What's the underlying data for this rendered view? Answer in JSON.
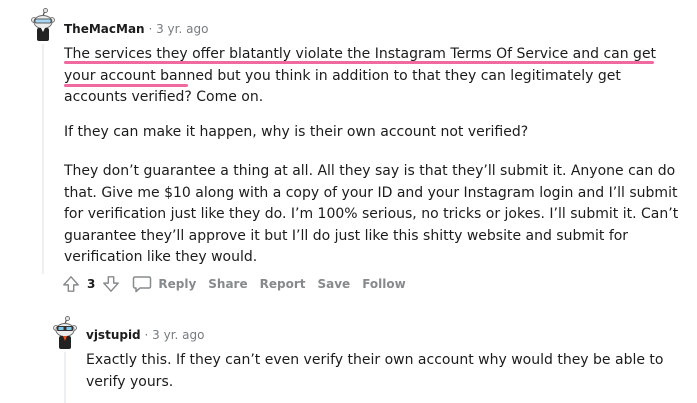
{
  "comments": [
    {
      "author": "TheMacMan",
      "separator": "·",
      "age": "3 yr. ago",
      "paragraphs": [
        {
          "highlighted_line1": "The services they offer blatantly violate the Instagram Terms Of Service and can get your",
          "highlighted_line2": "account banned",
          "rest": " but you think in addition to that they can legitimately get accounts verified? Come on."
        },
        {
          "text": "If they can make it happen, why is their own account not verified?"
        },
        {
          "text": "They don’t guarantee a thing at all. All they say is that they’ll submit it. Anyone can do that. Give me $10 along with a copy of your ID and your Instagram login and I’ll submit for verification just like they do. I’m 100% serious, no tricks or jokes. I’ll submit it. Can’t guarantee they’ll approve it but I’ll do just like this shitty website and submit for verification like they would."
        }
      ],
      "score": "3",
      "actions": {
        "reply": "Reply",
        "share": "Share",
        "report": "Report",
        "save": "Save",
        "follow": "Follow"
      },
      "highlight_color": "#f06aa0"
    },
    {
      "author": "vjstupid",
      "separator": "·",
      "age": "3 yr. ago",
      "text": "Exactly this. If they can’t even verify their own account why would they be able to verify yours."
    }
  ],
  "icons": [
    "snoo-avatar-icon",
    "upvote-icon",
    "downvote-icon",
    "reply-bubble-icon"
  ]
}
